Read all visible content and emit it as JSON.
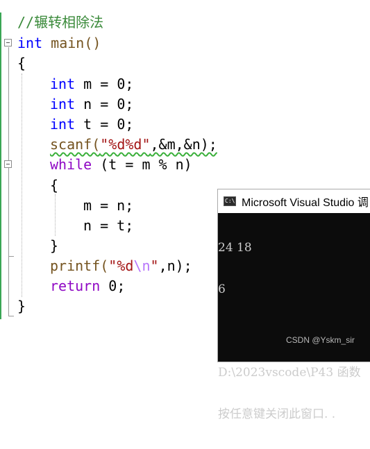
{
  "editor": {
    "comment": "//辗转相除法",
    "lines": {
      "l2_type": "int",
      "l2_name": " main()",
      "l3": "{",
      "l4_type": "int",
      "l4_rest": " m = 0;",
      "l5_type": "int",
      "l5_rest": " n = 0;",
      "l6_type": "int",
      "l6_rest": " t = 0;",
      "l7_fn": "scanf(",
      "l7_str": "\"%d%d\"",
      "l7_rest": ",&m,&n);",
      "l8_kw": "while",
      "l8_rest": " (t = m % n)",
      "l9": "{",
      "l10": "m = n;",
      "l11": "n = t;",
      "l12": "}",
      "l13_fn": "printf(",
      "l13_str_a": "\"%d",
      "l13_esc": "\\n",
      "l13_str_b": "\"",
      "l13_rest": ",n);",
      "l14_kw": "return",
      "l14_rest": " 0;",
      "l15": "}"
    }
  },
  "console": {
    "title": "Microsoft Visual Studio 调",
    "lines": [
      "24 18",
      "6",
      "",
      "D:\\2023vscode\\P43 函数",
      "按任意键关闭此窗口. ."
    ]
  },
  "watermark": "CSDN @Yskm_sir"
}
